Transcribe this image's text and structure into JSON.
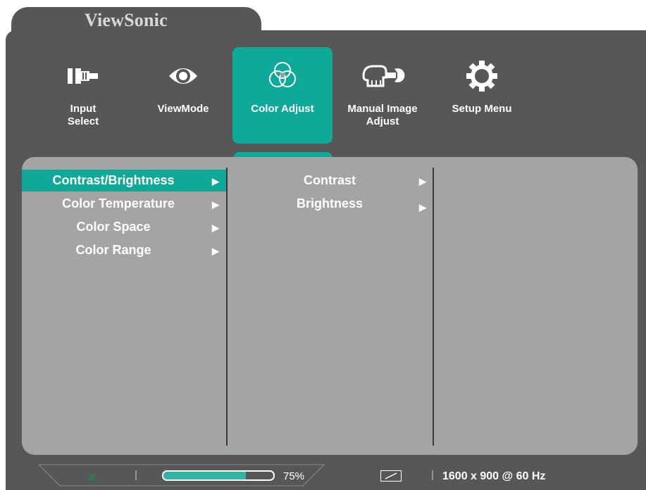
{
  "brand": "ViewSonic",
  "menu": [
    {
      "label_line1": "Input",
      "label_line2": "Select",
      "icon": "input-select-icon",
      "active": false
    },
    {
      "label_line1": "ViewMode",
      "label_line2": "",
      "icon": "eye-icon",
      "active": false
    },
    {
      "label_line1": "Color Adjust",
      "label_line2": "",
      "icon": "color-circles-icon",
      "active": true
    },
    {
      "label_line1": "Manual Image",
      "label_line2": "Adjust",
      "icon": "hand-wrench-icon",
      "active": false
    },
    {
      "label_line1": "Setup Menu",
      "label_line2": "",
      "icon": "gear-icon",
      "active": false
    }
  ],
  "submenu": [
    {
      "label": "Contrast/Brightness",
      "arrow": "▶",
      "active": true
    },
    {
      "label": "Color Temperature",
      "arrow": "▶",
      "active": false
    },
    {
      "label": "Color Space",
      "arrow": "▶",
      "active": false
    },
    {
      "label": "Color Range",
      "arrow": "▶",
      "active": false
    }
  ],
  "options": [
    {
      "label": "Contrast",
      "arrow": "▶"
    },
    {
      "label": "Brightness",
      "arrow": "▶"
    }
  ],
  "status": {
    "eco_label": "eco",
    "progress_value": 0.75,
    "progress_text": "75%",
    "resolution": "1600 x 900 @ 60 Hz"
  },
  "colors": {
    "accent": "#0fa99a",
    "background": "#575757",
    "panel": "#a4a4a4"
  }
}
